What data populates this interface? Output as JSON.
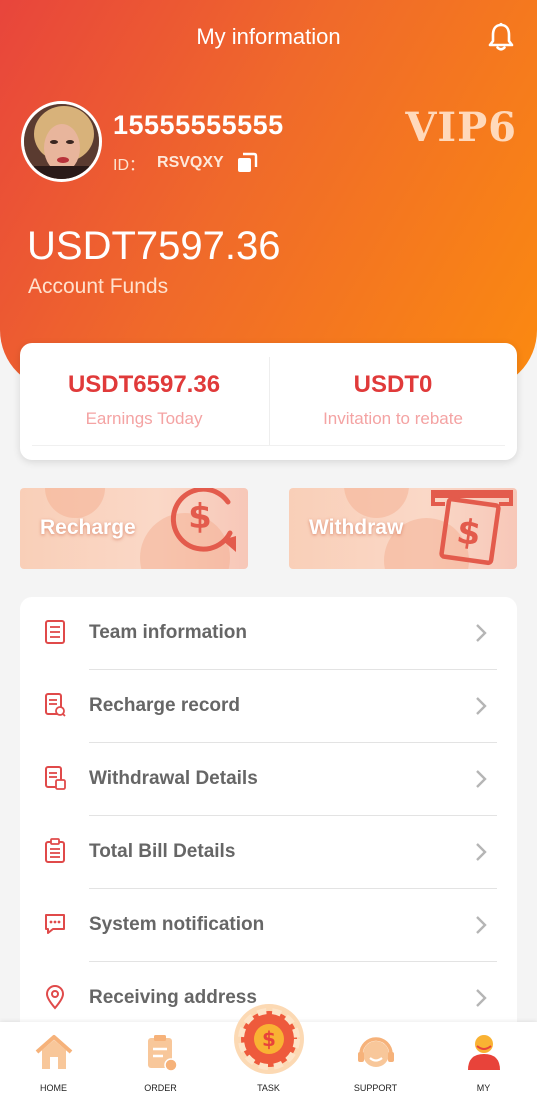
{
  "header": {
    "title": "My information",
    "bell_icon": "bell-icon"
  },
  "profile": {
    "phone": "15555555555",
    "id_label": "ID：",
    "id_value": "RSVQXY",
    "vip": "VIP6",
    "copy_icon": "copy-icon"
  },
  "funds": {
    "amount": "USDT7597.36",
    "label": "Account Funds"
  },
  "stats": [
    {
      "value": "USDT6597.36",
      "label": "Earnings Today"
    },
    {
      "value": "USDT0",
      "label": "Invitation to rebate"
    }
  ],
  "actions": {
    "recharge": "Recharge",
    "withdraw": "Withdraw"
  },
  "menu": [
    {
      "label": "Team information",
      "icon": "document-list-icon"
    },
    {
      "label": "Recharge record",
      "icon": "record-search-icon"
    },
    {
      "label": "Withdrawal Details",
      "icon": "withdraw-list-icon"
    },
    {
      "label": "Total Bill Details",
      "icon": "clipboard-icon"
    },
    {
      "label": "System notification",
      "icon": "chat-bubble-icon"
    },
    {
      "label": "Receiving address",
      "icon": "location-pin-icon"
    }
  ],
  "tabs": [
    {
      "label": "HOME",
      "icon": "home-icon"
    },
    {
      "label": "ORDER",
      "icon": "order-icon"
    },
    {
      "label": "TASK",
      "icon": "task-coin-icon"
    },
    {
      "label": "SUPPORT",
      "icon": "support-icon"
    },
    {
      "label": "MY",
      "icon": "user-icon",
      "active": true
    }
  ],
  "colors": {
    "accent": "#e03a3a",
    "orange": "#fb8a10",
    "red": "#e8453c"
  }
}
